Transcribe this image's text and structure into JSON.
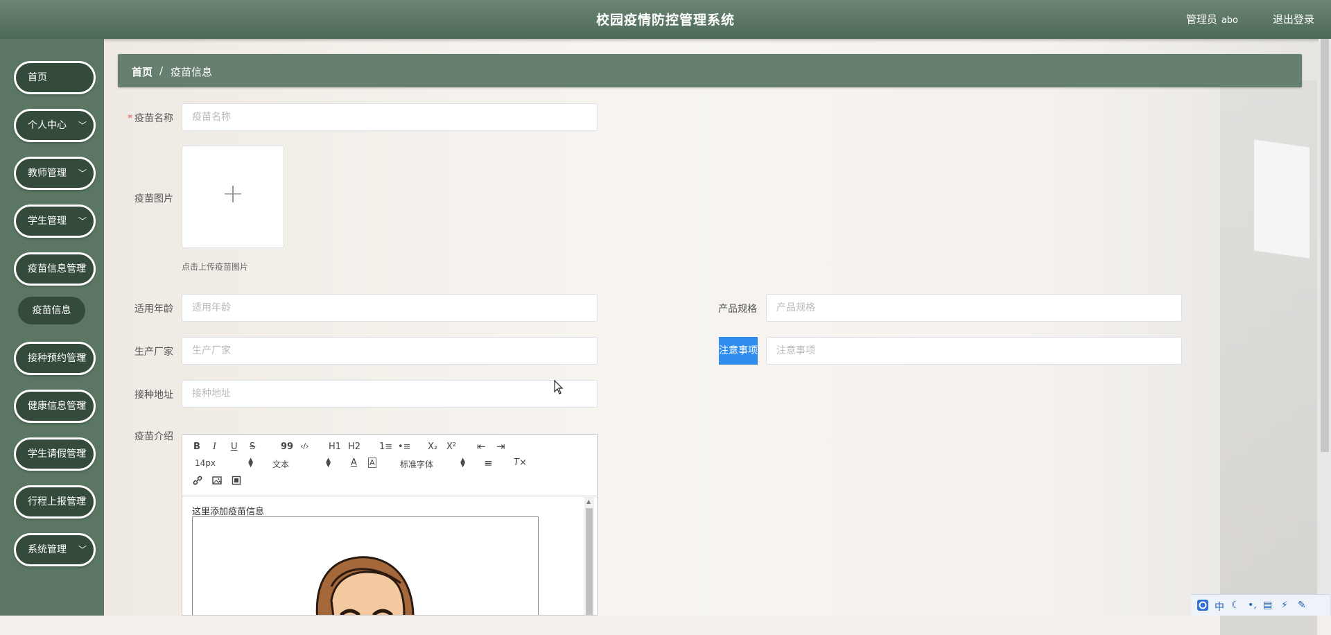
{
  "header": {
    "title": "校园疫情防控管理系统",
    "user_role": "管理员",
    "user_name": "abo",
    "logout": "退出登录"
  },
  "sidebar": {
    "items": [
      {
        "label": "首页",
        "has_arrow": false
      },
      {
        "label": "个人中心",
        "has_arrow": true
      },
      {
        "label": "教师管理",
        "has_arrow": true
      },
      {
        "label": "学生管理",
        "has_arrow": true
      },
      {
        "label": "疫苗信息管理",
        "has_arrow": true
      },
      {
        "label": "接种预约管理",
        "has_arrow": true
      },
      {
        "label": "健康信息管理",
        "has_arrow": true
      },
      {
        "label": "学生请假管理",
        "has_arrow": true
      },
      {
        "label": "行程上报管理",
        "has_arrow": true
      },
      {
        "label": "系统管理",
        "has_arrow": true
      }
    ],
    "sub_item": "疫苗信息"
  },
  "breadcrumb": {
    "home": "首页",
    "separator": "/",
    "current": "疫苗信息"
  },
  "form": {
    "name": {
      "label": "疫苗名称",
      "placeholder": "疫苗名称",
      "required_mark": "*"
    },
    "image": {
      "label": "疫苗图片",
      "plus": "+",
      "tip": "点击上传疫苗图片"
    },
    "age": {
      "label": "适用年龄",
      "placeholder": "适用年龄"
    },
    "spec": {
      "label": "产品规格",
      "placeholder": "产品规格"
    },
    "maker": {
      "label": "生产厂家",
      "placeholder": "生产厂家"
    },
    "notes": {
      "label": "注意事项",
      "placeholder": "注意事项"
    },
    "address": {
      "label": "接种地址",
      "placeholder": "接种地址"
    },
    "intro": {
      "label": "疫苗介绍"
    }
  },
  "editor": {
    "toolbar": {
      "bold": "B",
      "italic": "I",
      "underline": "U",
      "strike": "S",
      "quote": "99",
      "code": "‹/›",
      "h1": "H1",
      "h2": "H2",
      "ol": "1≡",
      "ul": "•≡",
      "sub": "X₂",
      "sup": "X²",
      "outdent": "⇤",
      "indent": "⇥",
      "size": "14px",
      "format": "文本",
      "font": "标准字体",
      "color": "A",
      "bg": "A",
      "align": "≡",
      "clear": "T×"
    },
    "content_text": "这里添加疫苗信息"
  },
  "ime": {
    "items": [
      "中",
      "☾",
      "•,",
      "▤",
      "⚡",
      "✎"
    ]
  },
  "colors": {
    "header": "#5a7663",
    "sidebar": "#5b7764",
    "nav_item": "#344a3b",
    "breadcrumb": "#677f6e",
    "highlight": "#2f8df0",
    "required": "#e24d4d"
  }
}
